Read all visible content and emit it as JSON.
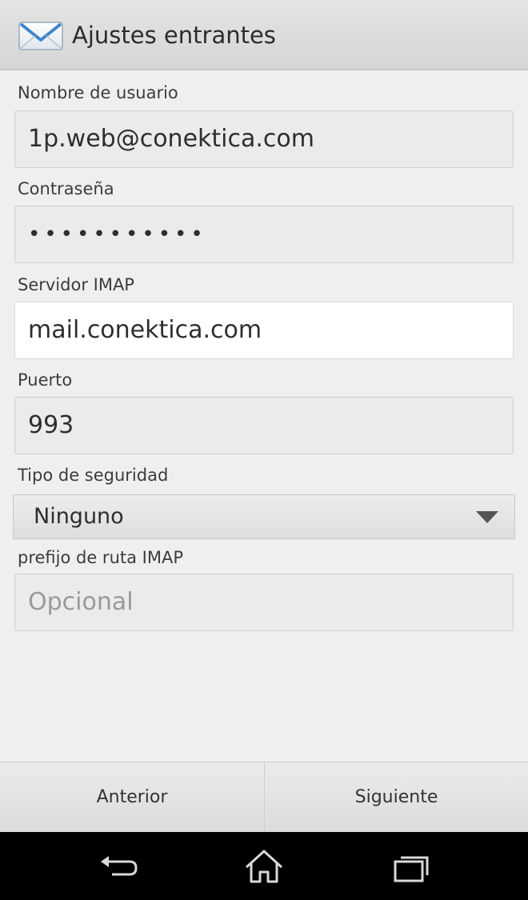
{
  "header": {
    "title": "Ajustes entrantes",
    "icon": "mail-envelope-icon"
  },
  "form": {
    "username": {
      "label": "Nombre de usuario",
      "value": "1p.web@conektica.com"
    },
    "password": {
      "label": "Contraseña",
      "value": "•••••••••••"
    },
    "imap_server": {
      "label": "Servidor IMAP",
      "value": "mail.conektica.com"
    },
    "port": {
      "label": "Puerto",
      "value": "993"
    },
    "security": {
      "label": "Tipo de seguridad",
      "selected": "Ninguno"
    },
    "imap_prefix": {
      "label": "prefijo de ruta IMAP",
      "placeholder": "Opcional"
    }
  },
  "buttons": {
    "previous": "Anterior",
    "next": "Siguiente"
  },
  "nav": {
    "back": "back-icon",
    "home": "home-icon",
    "recents": "recent-apps-icon"
  },
  "colors": {
    "background": "#efefed",
    "nav_bar": "#000000",
    "focused_field": "#ffffff"
  }
}
